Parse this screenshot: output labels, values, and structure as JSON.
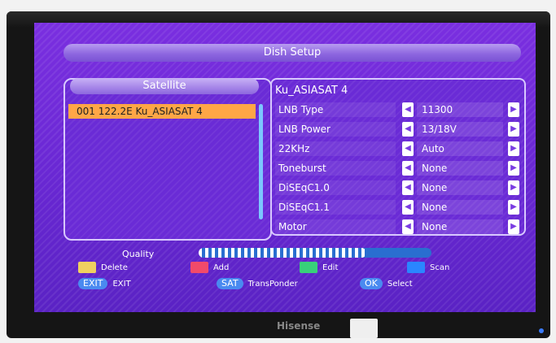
{
  "tv": {
    "brand": "Hisense",
    "colors": {
      "frame": "#151515",
      "screen_purple": "#6a28d4",
      "power_led": "#3b7cff"
    }
  },
  "window": {
    "title": "Dish Setup"
  },
  "satellite_panel": {
    "header": "Satellite",
    "items": [
      {
        "label": "001 122.2E Ku_ASIASAT 4",
        "selected": true
      }
    ]
  },
  "parameters_panel": {
    "title": "Ku_ASIASAT 4",
    "rows": [
      {
        "label": "LNB Type",
        "value": "11300"
      },
      {
        "label": "LNB Power",
        "value": "13/18V"
      },
      {
        "label": "22KHz",
        "value": "Auto"
      },
      {
        "label": "Toneburst",
        "value": "None"
      },
      {
        "label": "DiSEqC1.0",
        "value": "None"
      },
      {
        "label": "DiSEqC1.1",
        "value": "None"
      },
      {
        "label": "Motor",
        "value": "None"
      }
    ],
    "arrow_left_icon": "◀",
    "arrow_right_icon": "▶"
  },
  "quality": {
    "label": "Quality",
    "level_fraction": 0.72
  },
  "legend": [
    {
      "label": "Delete",
      "color": "#f0d060"
    },
    {
      "label": "Add",
      "color": "#f24a6a"
    },
    {
      "label": "Edit",
      "color": "#38d07a"
    },
    {
      "label": "Scan",
      "color": "#2a86ff"
    }
  ],
  "bottom": {
    "exit_key": "EXIT",
    "exit_label": "EXIT",
    "sat_key": "SAT",
    "sat_label": "TransPonder",
    "ok_key": "OK",
    "ok_label": "Select"
  }
}
